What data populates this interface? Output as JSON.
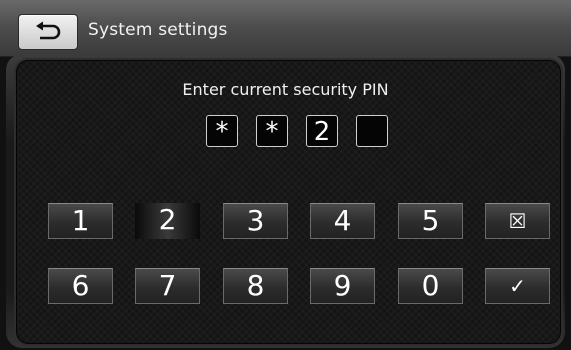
{
  "header": {
    "back_icon": "return-arrow-icon",
    "title": "System settings"
  },
  "prompt": "Enter current security PIN",
  "pin": [
    "*",
    "*",
    "2",
    ""
  ],
  "keypad": {
    "row1": [
      "1",
      "2",
      "3",
      "4",
      "5"
    ],
    "row2": [
      "6",
      "7",
      "8",
      "9",
      "0"
    ],
    "clear_icon": "☒",
    "confirm_icon": "✓"
  },
  "pressed_key": "2"
}
